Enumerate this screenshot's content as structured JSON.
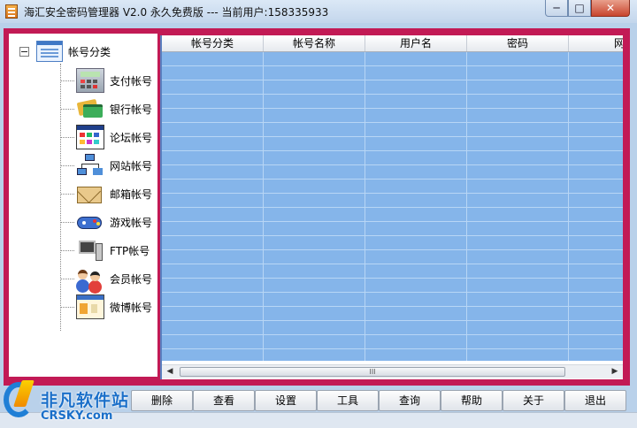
{
  "window": {
    "title": "海汇安全密码管理器 V2.0 永久免费版 --- 当前用户:158335933",
    "minimize_glyph": "─",
    "maximize_glyph": "□",
    "close_glyph": "✕"
  },
  "tree": {
    "root_label": "帐号分类",
    "items": [
      {
        "label": "支付帐号",
        "icon": "calculator-icon"
      },
      {
        "label": "银行帐号",
        "icon": "bank-card-icon"
      },
      {
        "label": "论坛帐号",
        "icon": "forum-window-icon"
      },
      {
        "label": "网站帐号",
        "icon": "network-icon"
      },
      {
        "label": "邮箱帐号",
        "icon": "envelope-icon"
      },
      {
        "label": "游戏帐号",
        "icon": "gamepad-icon"
      },
      {
        "label": "FTP帐号",
        "icon": "ftp-server-icon"
      },
      {
        "label": "会员帐号",
        "icon": "members-icon"
      },
      {
        "label": "微博帐号",
        "icon": "weibo-window-icon"
      }
    ]
  },
  "grid": {
    "columns": [
      "帐号分类",
      "帐号名称",
      "用户名",
      "密码",
      "网"
    ],
    "scroll_grip": "III",
    "scroll_left": "◀",
    "scroll_right": "▶"
  },
  "toolbar": {
    "buttons": [
      "删除",
      "查看",
      "设置",
      "工具",
      "查询",
      "帮助",
      "关于",
      "退出"
    ]
  },
  "watermark": {
    "cn": "非凡软件站",
    "en": "CRSKY.com"
  },
  "colors": {
    "frame": "#c21a55",
    "grid_fill": "#85b5ea",
    "grid_line": "#b8d6f5"
  }
}
